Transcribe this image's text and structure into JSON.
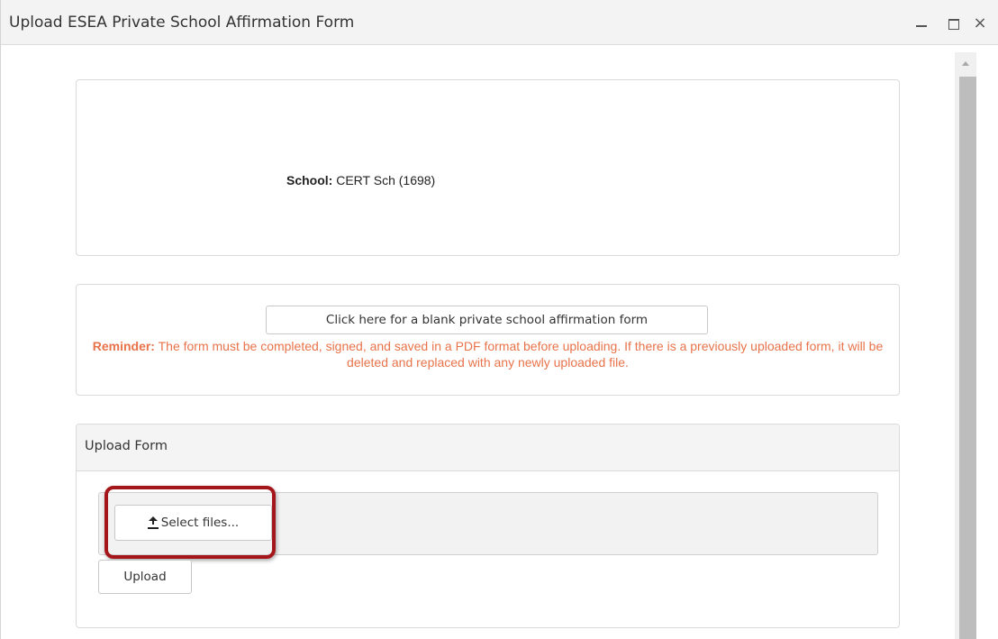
{
  "window": {
    "title": "Upload ESEA Private School Affirmation Form",
    "controls": {
      "minimize": "minimize",
      "maximize": "maximize",
      "close": "×"
    }
  },
  "school": {
    "label": "School:",
    "value": "CERT Sch (1698)"
  },
  "form_section": {
    "blank_form_button": "Click here for a blank private school affirmation form",
    "reminder_label": "Reminder:",
    "reminder_text": "The form must be completed, signed, and saved in a PDF format before uploading. If there is a previously uploaded form, it will be deleted and replaced with any newly uploaded file."
  },
  "upload_section": {
    "header": "Upload Form",
    "select_files_button": "Select files...",
    "upload_button": "Upload",
    "select_icon": "upload-icon"
  },
  "colors": {
    "reminder": "#e8734a",
    "highlight": "#a4161a"
  }
}
